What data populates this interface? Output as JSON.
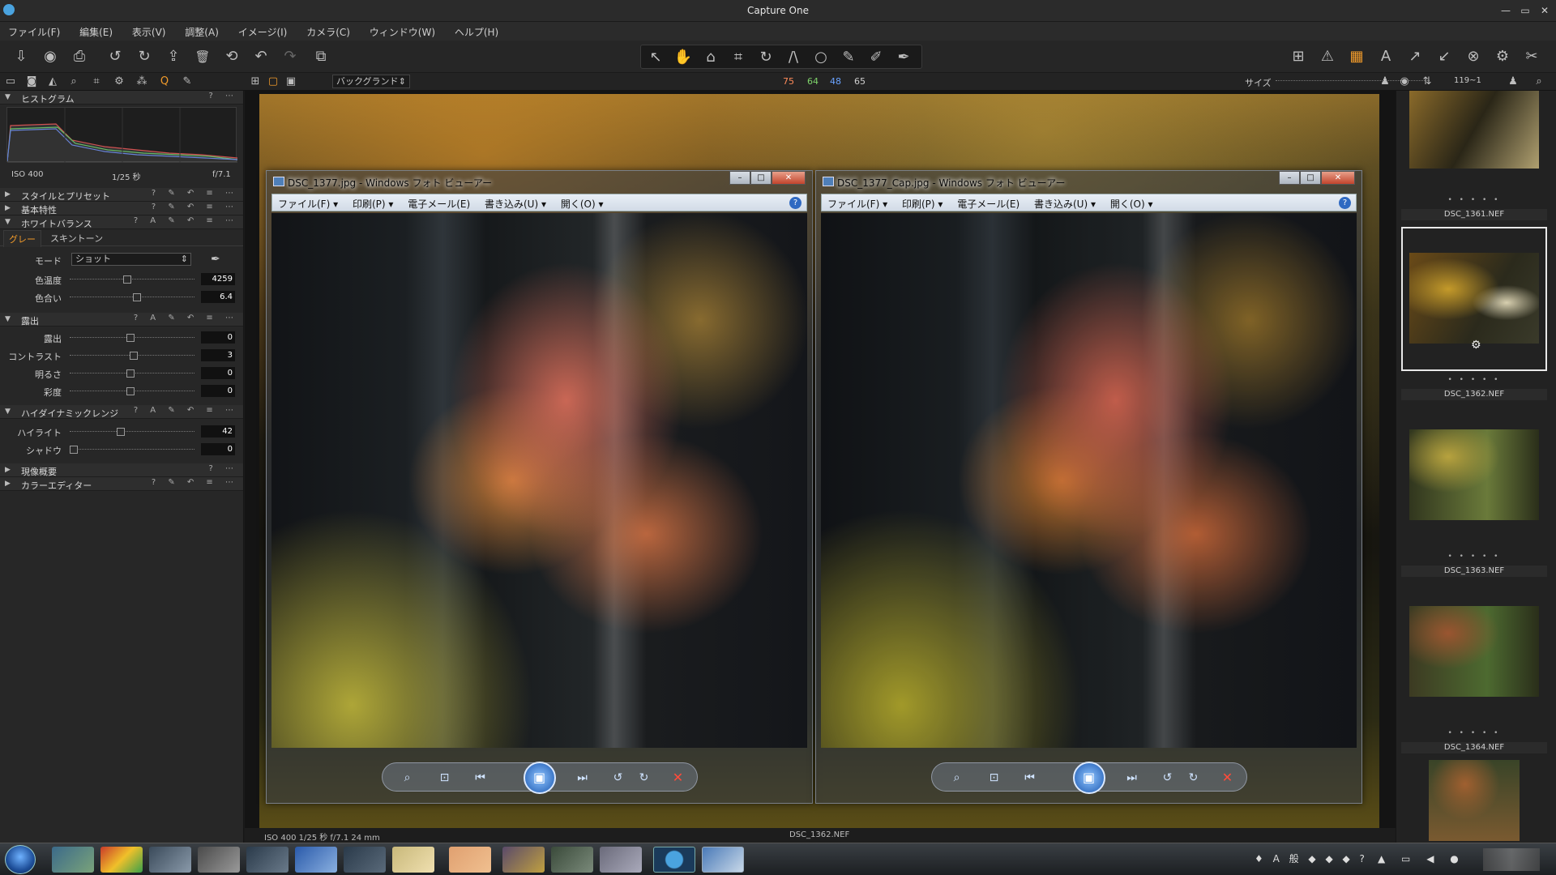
{
  "window": {
    "title": "Capture One",
    "min": "—",
    "max": "▭",
    "close": "✕"
  },
  "menu": [
    "ファイル(F)",
    "編集(E)",
    "表示(V)",
    "調整(A)",
    "イメージ(I)",
    "カメラ(C)",
    "ウィンドウ(W)",
    "ヘルプ(H)"
  ],
  "toolbar2": {
    "background_select": "バックグランド",
    "numbers": [
      "75",
      "64",
      "48",
      "65"
    ],
    "size_label": "サイズ",
    "counter": "119~1"
  },
  "left": {
    "histogram": {
      "title": "ヒストグラム",
      "iso": "ISO 400",
      "shutter": "1/25 秒",
      "aperture": "f/7.1"
    },
    "sections": {
      "style": "スタイルとプリセット",
      "basic": "基本特性",
      "wb": "ホワイトバランス",
      "exposure": "露出",
      "hdr": "ハイダイナミックレンジ",
      "dev": "現像概要",
      "color": "カラーエディター"
    },
    "wb_tabs": [
      "グレー",
      "スキントーン"
    ],
    "wb_mode_label": "モード",
    "wb_mode_value": "ショット",
    "wb_rows": [
      {
        "label": "色温度",
        "value": "4259"
      },
      {
        "label": "色合い",
        "value": "6.4"
      }
    ],
    "exposure_rows": [
      {
        "label": "露出",
        "value": "0"
      },
      {
        "label": "コントラスト",
        "value": "3"
      },
      {
        "label": "明るさ",
        "value": "0"
      },
      {
        "label": "彩度",
        "value": "0"
      }
    ],
    "hdr_rows": [
      {
        "label": "ハイライト",
        "value": "42"
      },
      {
        "label": "シャドウ",
        "value": "0"
      }
    ]
  },
  "viewer": {
    "status_left": "ISO 400  1/25 秒  f/7.1  24 mm",
    "status_center": "DSC_1362.NEF"
  },
  "photoviewers": [
    {
      "title": "DSC_1377.jpg - Windows フォト ビューアー",
      "menu": [
        "ファイル(F) ▾",
        "印刷(P) ▾",
        "電子メール(E)",
        "書き込み(U) ▾",
        "開く(O) ▾"
      ]
    },
    {
      "title": "DSC_1377_Cap.jpg - Windows フォト ビューアー",
      "menu": [
        "ファイル(F) ▾",
        "印刷(P) ▾",
        "電子メール(E)",
        "書き込み(U) ▾",
        "開く(O) ▾"
      ]
    }
  ],
  "filmstrip": [
    {
      "name": "",
      "dots": "",
      "colors": [
        "#6a4a17",
        "#2b2a1c",
        "#8a6d2c"
      ]
    },
    {
      "name": "DSC_1361.NEF",
      "dots": "• • • • •",
      "colors": [
        "#b07a22",
        "#3a3a22",
        "#6e6740"
      ]
    },
    {
      "name": "DSC_1362.NEF",
      "dots": "• • • • •",
      "colors": [
        "#b7a23e",
        "#31361e",
        "#6a7a3a"
      ]
    },
    {
      "name": "DSC_1363.NEF",
      "dots": "• • • • •",
      "colors": [
        "#9a5530",
        "#3c3a22",
        "#4d6a30"
      ]
    },
    {
      "name": "DSC_1364.NEF",
      "dots": "• • • • •",
      "colors": [
        "#a06030",
        "#394428",
        "#7a5a30"
      ]
    }
  ],
  "icons": {
    "import": "⇩",
    "capture": "◉",
    "print": "⎙",
    "rotate_left": "↺",
    "rotate_right": "↻",
    "export": "⇪",
    "trash": "🗑",
    "undo": "↶",
    "redo": "↷"
  }
}
